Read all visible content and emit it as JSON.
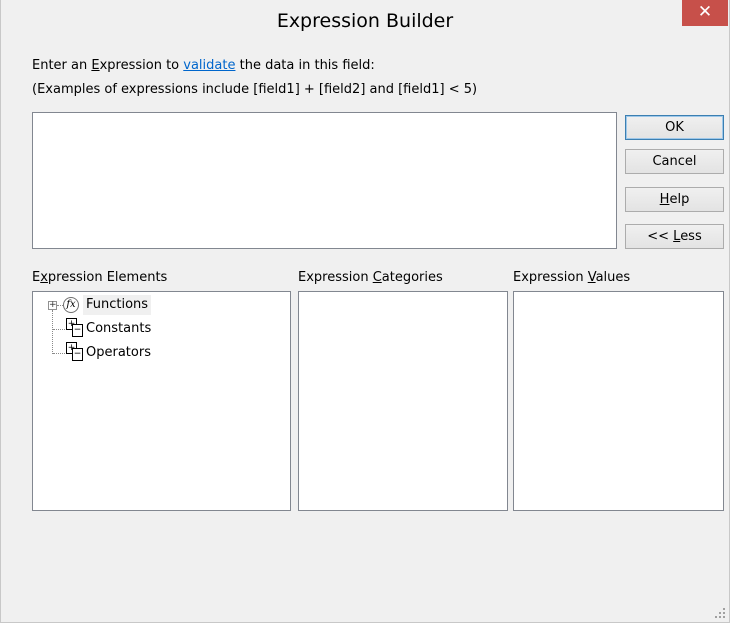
{
  "window": {
    "title": "Expression Builder",
    "close_glyph": "✕"
  },
  "prompt": {
    "line1_pre": "Enter an ",
    "line1_key": "E",
    "line1_rest": "xpression to ",
    "line1_link": "validate",
    "line1_post": " the data in this field:",
    "line2": "(Examples of expressions include [field1] + [field2] and [field1] < 5)"
  },
  "expression_input": {
    "value": ""
  },
  "buttons": {
    "ok": "OK",
    "cancel": "Cancel",
    "help_key": "H",
    "help_rest": "elp",
    "less_pre": "<< ",
    "less_key": "L",
    "less_rest": "ess"
  },
  "panels": {
    "elements_label_pre": "E",
    "elements_label_key": "x",
    "elements_label_rest": "pression Elements",
    "categories_label_pre": "Expression ",
    "categories_label_key": "C",
    "categories_label_rest": "ategories",
    "values_label_pre": "Expression ",
    "values_label_key": "V",
    "values_label_rest": "alues"
  },
  "tree": {
    "items": [
      {
        "label": "Functions",
        "icon": "fx-icon"
      },
      {
        "label": "Constants",
        "icon": "constants-icon"
      },
      {
        "label": "Operators",
        "icon": "operators-icon"
      }
    ]
  }
}
